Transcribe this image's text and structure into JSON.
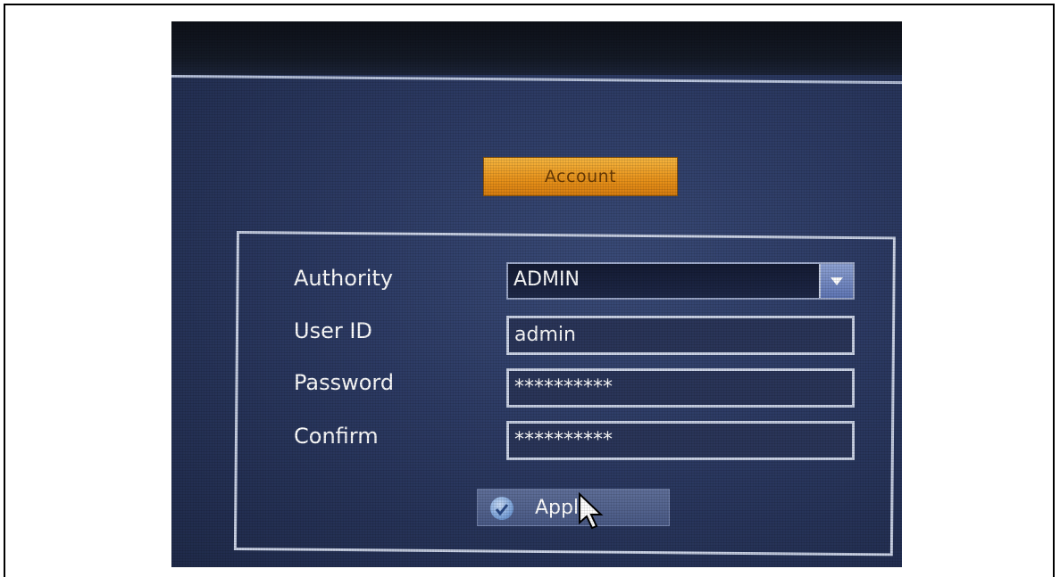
{
  "account_tab": {
    "label": "Account"
  },
  "form": {
    "authority": {
      "label": "Authority",
      "value": "ADMIN"
    },
    "user_id": {
      "label": "User ID",
      "value": "admin"
    },
    "password": {
      "label": "Password",
      "value": "**********"
    },
    "confirm": {
      "label": "Confirm",
      "value": "**********"
    }
  },
  "apply_button": {
    "label": "Apply"
  },
  "icons": {
    "dropdown": "chevron-down-icon",
    "apply": "check-icon",
    "cursor": "cursor-arrow-icon"
  },
  "colors": {
    "accent": "#e8921a",
    "background": "#2c3a63",
    "border": "#c9d1e4"
  }
}
